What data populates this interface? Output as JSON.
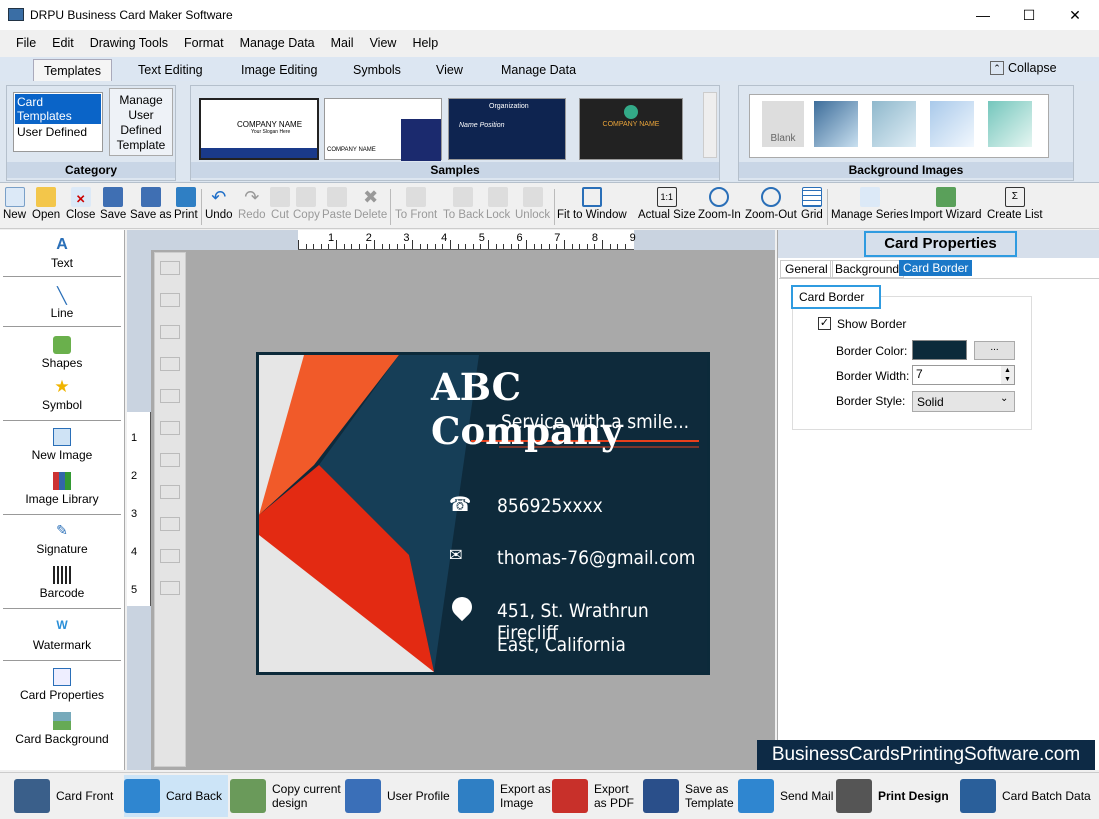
{
  "window": {
    "title": "DRPU Business Card Maker Software",
    "minimize": "—",
    "maximize": "☐",
    "close": "✕"
  },
  "menu": [
    "File",
    "Edit",
    "Drawing Tools",
    "Format",
    "Manage Data",
    "Mail",
    "View",
    "Help"
  ],
  "ribbon_tabs": [
    "Templates",
    "Text Editing",
    "Image Editing",
    "Symbols",
    "View",
    "Manage Data"
  ],
  "collapse_label": "Collapse",
  "category": {
    "items": [
      "Card Templates",
      "User Defined"
    ],
    "manage_button": "Manage User Defined Template",
    "label": "Category"
  },
  "samples": {
    "label": "Samples",
    "items": [
      {
        "title": "COMPANY NAME",
        "subtitle": "Your Slogan Here"
      },
      {
        "title": "COMPANY NAME",
        "subtitle": ""
      },
      {
        "title": "Organization",
        "subtitle": "Name Position"
      },
      {
        "title": "COMPANY NAME",
        "subtitle": ""
      }
    ]
  },
  "background_images": {
    "label": "Background Images",
    "blank": "Blank"
  },
  "toolbar": [
    "New",
    "Open",
    "Close",
    "Save",
    "Save as",
    "Print",
    "Undo",
    "Redo",
    "Cut",
    "Copy",
    "Paste",
    "Delete",
    "To Front",
    "To Back",
    "Lock",
    "Unlock",
    "Fit to Window",
    "Actual Size",
    "Zoom-In",
    "Zoom-Out",
    "Grid",
    "Manage Series",
    "Import Wizard",
    "Create List"
  ],
  "left_tools": [
    "Text",
    "Line",
    "Shapes",
    "Symbol",
    "New Image",
    "Image Library",
    "Signature",
    "Barcode",
    "Watermark",
    "Card Properties",
    "Card Background"
  ],
  "ruler": {
    "top": [
      "1",
      "2",
      "3",
      "4",
      "5",
      "6",
      "7",
      "8",
      "9"
    ],
    "left": [
      "1",
      "2",
      "3",
      "4",
      "5"
    ]
  },
  "card": {
    "company": "ABC Company",
    "slogan": "Service with a smile...",
    "phone": "856925xxxx",
    "email": "thomas-76@gmail.com",
    "address_line1": "451, St. Wrathrun Firecliff",
    "address_line2": "East, California",
    "colors": {
      "bg": "#0e2a3b",
      "accent": "#e8401c",
      "light": "#e6e6e6"
    }
  },
  "properties": {
    "title": "Card Properties",
    "tabs": [
      "General",
      "Background",
      "Card Border"
    ],
    "active_tab": "Card Border",
    "group": "Card Border",
    "show_border_label": "Show Border",
    "show_border": true,
    "border_color_label": "Border Color:",
    "border_color": "#0c2a3a",
    "browse": "...",
    "border_width_label": "Border Width:",
    "border_width": "7",
    "border_style_label": "Border Style:",
    "border_style": "Solid"
  },
  "watermark": "BusinessCardsPrintingSoftware.com",
  "bottom": [
    "Card Front",
    "Card Back",
    "Copy current design",
    "User Profile",
    "Export as Image",
    "Export as PDF",
    "Save as Template",
    "Send Mail",
    "Print Design",
    "Card Batch Data"
  ]
}
